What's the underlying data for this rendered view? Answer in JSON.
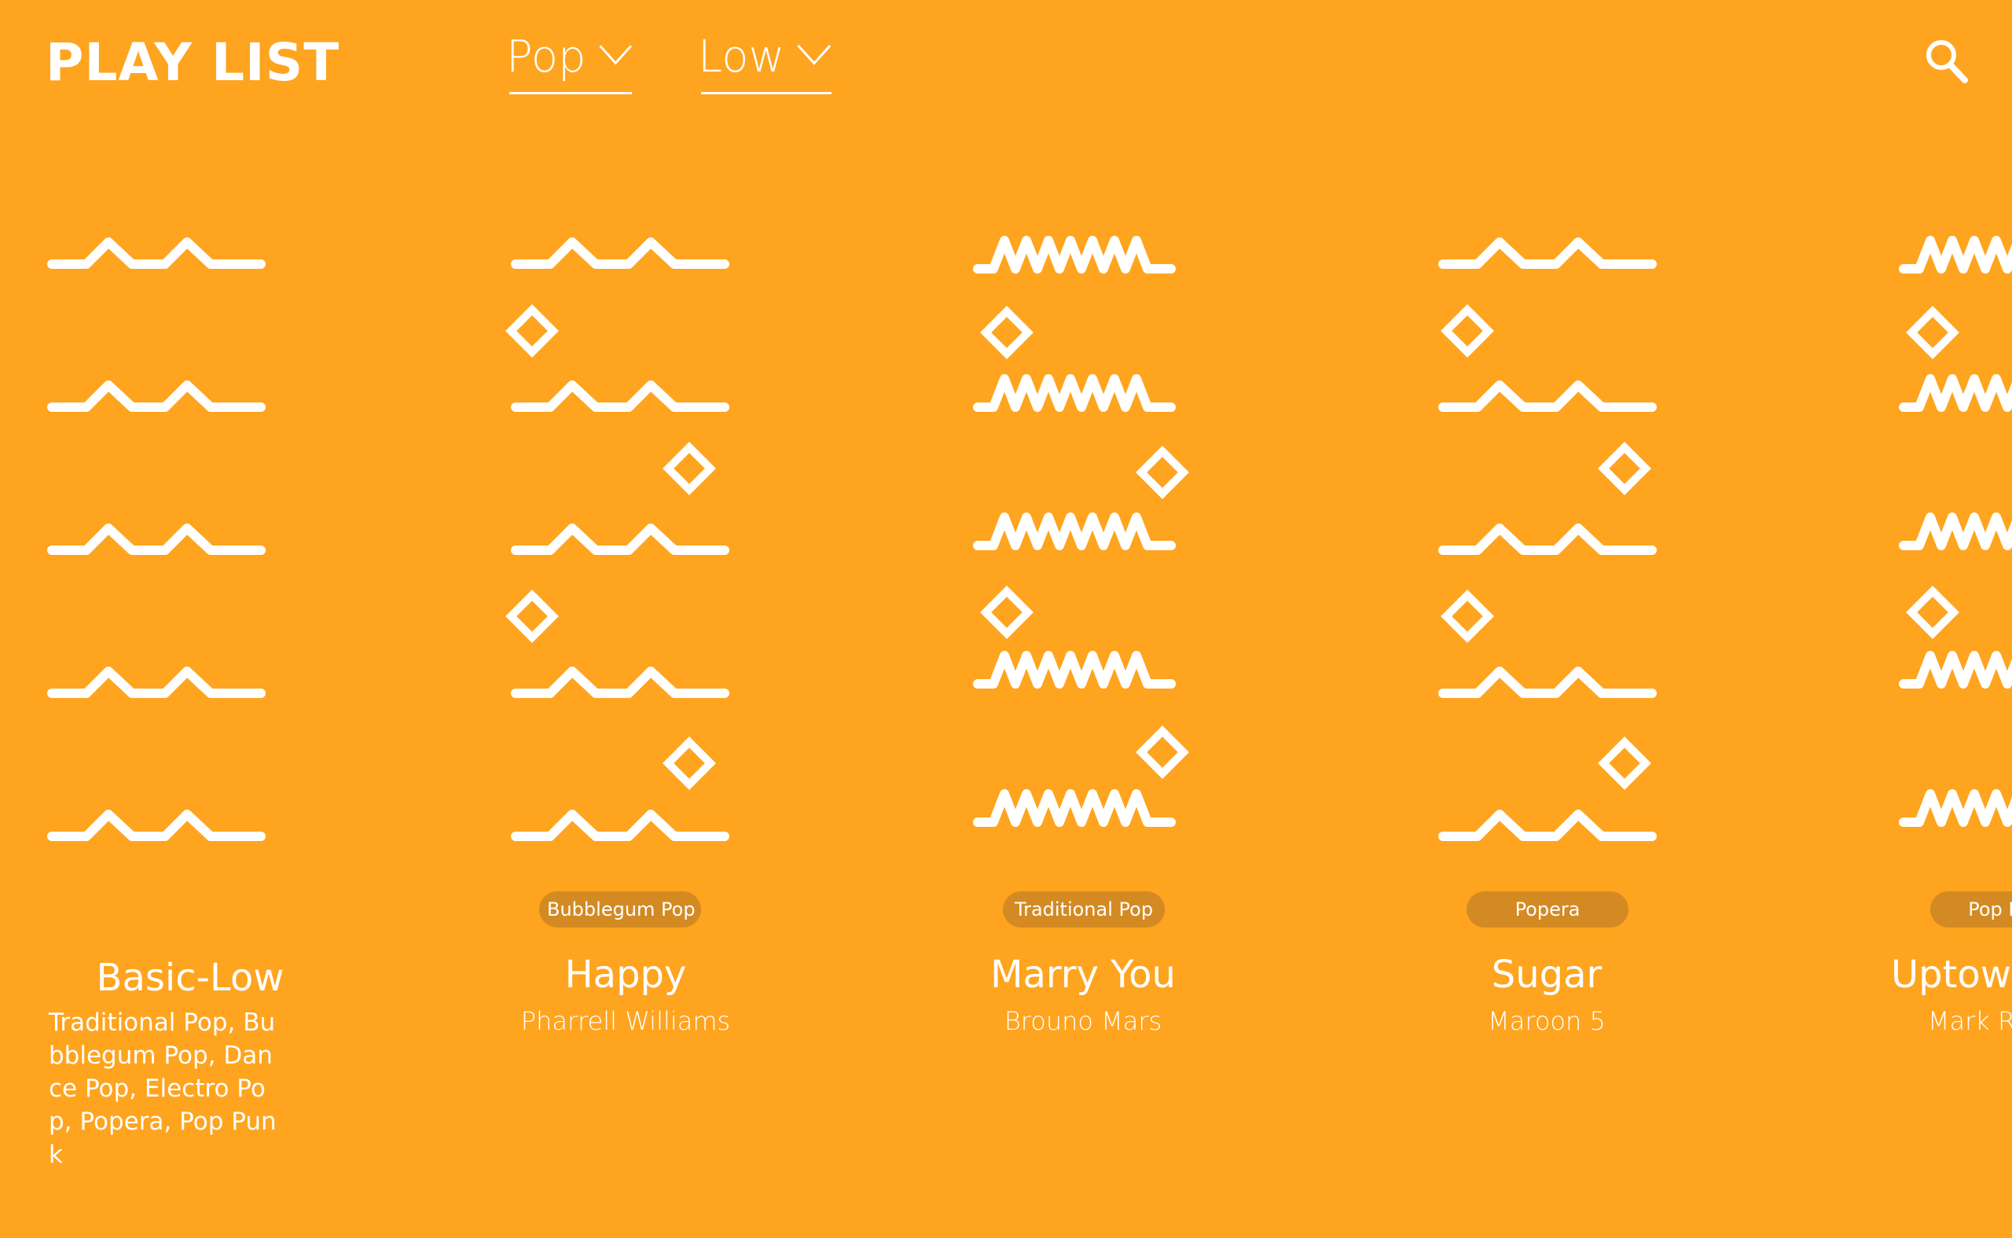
{
  "header": {
    "title": "PLAY LIST",
    "genre_filter": {
      "selected": "Pop"
    },
    "level_filter": {
      "selected": "Low"
    }
  },
  "icons": {
    "search": "search-icon",
    "chevron": "chevron-down-icon"
  },
  "colors": {
    "background": "#FFA41F",
    "foreground": "#FFFFFF",
    "badge": "#D48A22"
  },
  "playlists": [
    {
      "title": "Basic-Low",
      "description": "Traditional Pop, Bubblegum Pop, Dance Pop, Electro Pop, Popera, Pop Punk",
      "pattern": "gentle-wave"
    },
    {
      "badge": "Bubblegum Pop",
      "title": "Happy",
      "artist": "Pharrell Williams",
      "pattern": "gentle-wave-with-diamonds"
    },
    {
      "badge": "Traditional Pop",
      "title": "Marry You",
      "artist": "Brouno Mars",
      "pattern": "zigzag-with-diamonds"
    },
    {
      "badge": "Popera",
      "title": "Sugar",
      "artist": "Maroon 5",
      "pattern": "gentle-wave-with-diamonds"
    },
    {
      "badge": "Pop Punk",
      "title": "Uptown Funk",
      "artist": "Mark Ronson",
      "pattern": "zigzag-with-diamonds"
    }
  ]
}
